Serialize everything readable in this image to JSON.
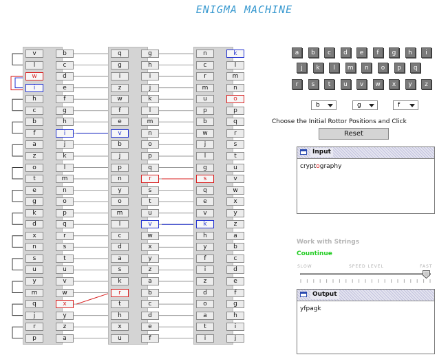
{
  "title": "ENIGMA MACHINE",
  "colors": {
    "red": "#d82020",
    "blue": "#2030d0",
    "title": "#3a9ad0",
    "green": "#22cc22"
  },
  "panels": [
    {
      "name": "reflector",
      "left": [
        "v",
        "l",
        "w",
        "i",
        "h",
        "c",
        "b",
        "f",
        "a",
        "z",
        "o",
        "t",
        "e",
        "g",
        "k",
        "d",
        "x",
        "n",
        "s",
        "u",
        "y",
        "m",
        "q",
        "j",
        "r",
        "p"
      ],
      "right": [
        "b",
        "c",
        "d",
        "e",
        "f",
        "g",
        "h",
        "i",
        "j",
        "k",
        "l",
        "m",
        "n",
        "o",
        "p",
        "q",
        "r",
        "s",
        "t",
        "u",
        "v",
        "w",
        "x",
        "y",
        "z",
        "a"
      ]
    },
    {
      "name": "rotor-1",
      "left": [
        "q",
        "g",
        "i",
        "z",
        "w",
        "f",
        "e",
        "v",
        "b",
        "j",
        "p",
        "n",
        "y",
        "o",
        "m",
        "l",
        "c",
        "d",
        "a",
        "s",
        "k",
        "r",
        "t",
        "h",
        "x",
        "u"
      ],
      "right": [
        "g",
        "h",
        "i",
        "j",
        "k",
        "l",
        "m",
        "n",
        "o",
        "p",
        "q",
        "r",
        "s",
        "t",
        "u",
        "v",
        "w",
        "x",
        "y",
        "z",
        "a",
        "b",
        "c",
        "d",
        "e",
        "f"
      ]
    },
    {
      "name": "rotor-2",
      "left": [
        "n",
        "c",
        "r",
        "m",
        "u",
        "p",
        "b",
        "w",
        "j",
        "l",
        "g",
        "s",
        "q",
        "e",
        "v",
        "k",
        "h",
        "y",
        "f",
        "i",
        "z",
        "d",
        "o",
        "a",
        "t",
        "i"
      ],
      "right": [
        "k",
        "l",
        "m",
        "n",
        "o",
        "p",
        "q",
        "r",
        "s",
        "t",
        "u",
        "v",
        "w",
        "x",
        "y",
        "z",
        "a",
        "b",
        "c",
        "d",
        "e",
        "f",
        "g",
        "h",
        "i",
        "j"
      ]
    }
  ],
  "keyboard": [
    [
      "a",
      "b",
      "c",
      "d",
      "e",
      "f",
      "g",
      "h",
      "i"
    ],
    [
      "j",
      "k",
      "l",
      "m",
      "n",
      "o",
      "p",
      "q"
    ],
    [
      "r",
      "s",
      "t",
      "u",
      "v",
      "w",
      "x",
      "y",
      "z"
    ]
  ],
  "rotor_selects": [
    "b",
    "g",
    "f"
  ],
  "choose_text": "Choose the Initial Rottor Positions and Click",
  "reset_label": "Reset",
  "input_window": {
    "title": "Input",
    "text_before": "crypt",
    "text_highlight": "o",
    "text_after": "graphy"
  },
  "strings_label": "Work with Strings",
  "continue_label": "Countinue",
  "speed": {
    "slow": "SLOW",
    "mid": "SPEED LEVEL",
    "fast": "FAST",
    "level": 1.0
  },
  "output_window": {
    "title": "Output",
    "text": "yfpagk"
  }
}
